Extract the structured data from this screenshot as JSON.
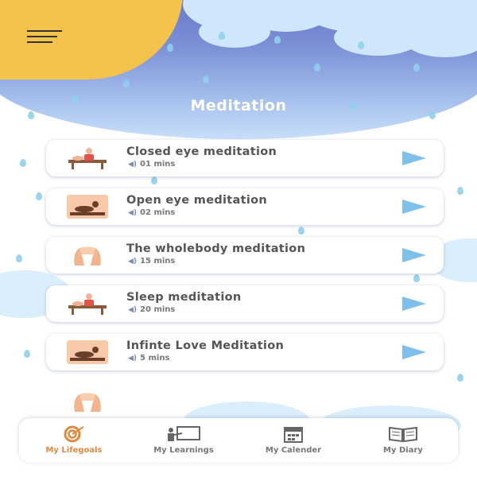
{
  "header": {
    "title": "Meditation",
    "menu_icon": "hamburger-menu-icon",
    "sun_color": "#f5c24c"
  },
  "meditations": [
    {
      "title": "Closed eye meditation",
      "duration": "01 mins",
      "icon": "massage-table-icon"
    },
    {
      "title": "Open eye meditation",
      "duration": "02 mins",
      "icon": "reclining-person-icon"
    },
    {
      "title": "The wholebody meditation",
      "duration": "15 mins",
      "icon": "hands-icon"
    },
    {
      "title": "Sleep meditation",
      "duration": "20 mins",
      "icon": "massage-table-icon"
    },
    {
      "title": "Infinte Love Meditation",
      "duration": "5 mins",
      "icon": "reclining-person-icon"
    }
  ],
  "nav": {
    "items": [
      {
        "label": "My Lifegoals",
        "icon": "target-icon",
        "active": true
      },
      {
        "label": "My Learnings",
        "icon": "presentation-icon",
        "active": false
      },
      {
        "label": "My Calender",
        "icon": "calendar-icon",
        "active": false
      },
      {
        "label": "My Diary",
        "icon": "book-icon",
        "active": false
      }
    ]
  },
  "colors": {
    "accent": "#e0893c",
    "play": "#7fc0eb",
    "sky_top": "#5b6cc2",
    "sky_bottom": "#c9defa"
  }
}
